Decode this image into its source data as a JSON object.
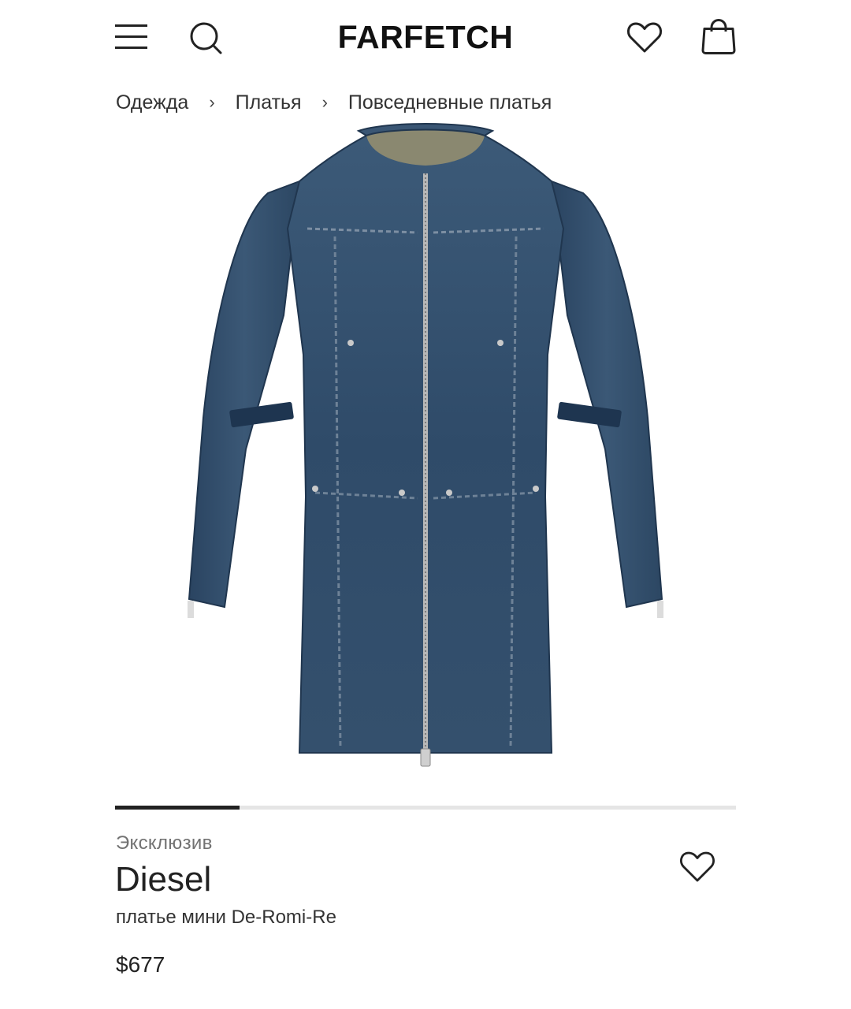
{
  "header": {
    "logo": "FARFETCH",
    "menu_icon": "hamburger-menu-icon",
    "search_icon": "search-icon",
    "wishlist_icon": "heart-icon",
    "bag_icon": "shopping-bag-icon"
  },
  "breadcrumb": {
    "items": [
      "Одежда",
      "Платья",
      "Повседневные платья"
    ],
    "separator": "›"
  },
  "product": {
    "image_alt": "",
    "gallery_progress": 0.2,
    "badge": "Эксклюзив",
    "brand": "Diesel",
    "name": "платье мини De-Romi-Re",
    "price": "$677",
    "wishlist_icon": "heart-icon"
  },
  "colors": {
    "text": "#222222",
    "muted": "#727272",
    "denim": "#2e4a68"
  }
}
